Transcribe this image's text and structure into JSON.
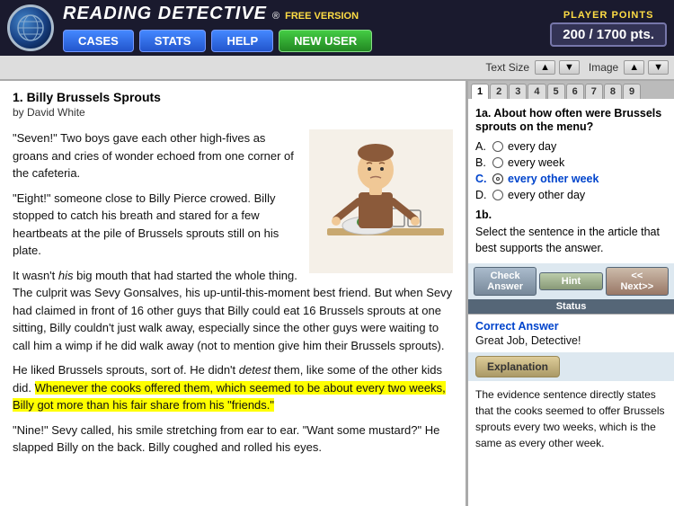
{
  "app": {
    "title": "READING DETECTIVE",
    "registered_symbol": "®",
    "free_version": "FREE VERSION",
    "logo_icon": "globe-icon"
  },
  "nav": {
    "cases_label": "CASES",
    "stats_label": "STATS",
    "help_label": "HELP",
    "new_user_label": "NEW USER"
  },
  "player_points": {
    "label": "PLAYER POINTS",
    "value": "200 / 1700 pts."
  },
  "toolbar": {
    "text_size_label": "Text Size",
    "image_label": "Image",
    "up_arrow": "▲",
    "down_arrow": "▼"
  },
  "story": {
    "title": "1. Billy Brussels Sprouts",
    "author": "by  David White",
    "paragraphs": [
      {
        "id": "p1",
        "text": "\"Seven!\" Two boys gave each other high-fives as groans and cries of wonder echoed from one corner of the cafeteria."
      },
      {
        "id": "p2",
        "text": "\"Eight!\" someone close to Billy Pierce crowed. Billy stopped to catch his breath and stared for a few heartbeats at the pile of Brussels sprouts still on his plate."
      },
      {
        "id": "p3",
        "text": "It wasn't his big mouth that had started the whole thing. The culprit was Sevy Gonsalves, his up-until-this-moment best friend. But when Sevy had claimed in front of 16 other guys that Billy could eat 16 Brussels sprouts at one sitting, Billy couldn't just walk away, especially since the other guys were waiting to call him a wimp if he did walk away (not to mention give him their Brussels sprouts)."
      },
      {
        "id": "p4",
        "text": "He liked Brussels sprouts, sort of. He didn't detest them, like some of the other kids did. Whenever the cooks offered them, which seemed to be about every two weeks, Billy got more than his fair share from his \"friends.\""
      },
      {
        "id": "p5",
        "text": "\"Nine!\" Sevy called, his smile stretching from ear to ear. \"Want some mustard?\" He slapped Billy on the back. Billy coughed and rolled his eyes."
      }
    ],
    "highlighted_text": "Whenever the cooks offered them, which seemed to be about every two weeks, Billy got more than his fair share from his \"friends.\""
  },
  "questions": {
    "tabs": [
      "1",
      "2",
      "3",
      "4",
      "5",
      "6",
      "7",
      "8",
      "9"
    ],
    "active_tab": "1",
    "q1a_label": "1a.",
    "q1a_text": "About how often were Brussels sprouts on the menu?",
    "options": [
      {
        "letter": "A.",
        "text": "every day",
        "selected": false
      },
      {
        "letter": "B.",
        "text": "every week",
        "selected": false
      },
      {
        "letter": "C.",
        "text": "every other week",
        "selected": true,
        "correct": true
      },
      {
        "letter": "D.",
        "text": "every other day",
        "selected": false
      }
    ],
    "q1b_label": "1b.",
    "q1b_text": "Select the sentence in the article that best supports the answer."
  },
  "action_buttons": {
    "check_label": "Check Answer",
    "hint_label": "Hint",
    "next_label": "<< Next>>",
    "status_label": "Status"
  },
  "correct_answer": {
    "title": "Correct Answer",
    "text": "Great Job, Detective!"
  },
  "explanation_button": {
    "label": "Explanation"
  },
  "explanation": {
    "text": "The evidence sentence directly states that the cooks seemed to offer Brussels sprouts every two weeks, which is the same as every other week."
  }
}
